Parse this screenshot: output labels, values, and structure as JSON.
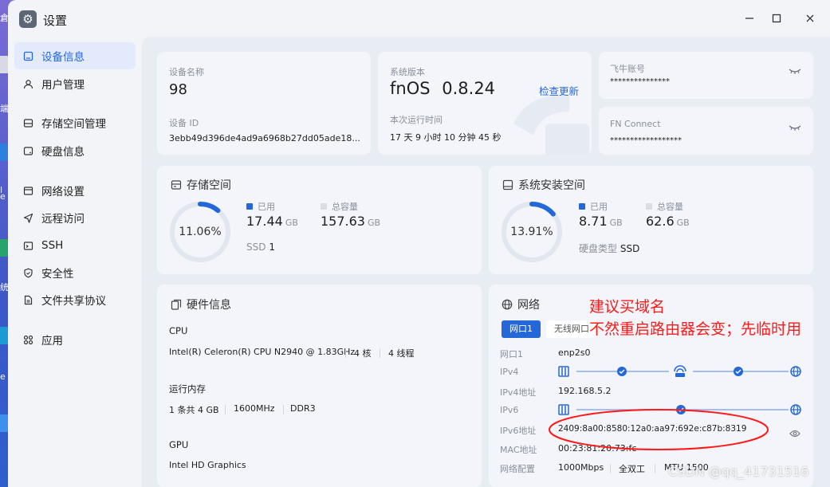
{
  "window": {
    "title": "设置"
  },
  "desktop": {
    "letters": [
      "倉",
      "端",
      "l",
      "e",
      "统",
      "e"
    ]
  },
  "sidebar": {
    "items": [
      {
        "label": "设备信息",
        "icon": "device-icon",
        "active": true
      },
      {
        "label": "用户管理",
        "icon": "user-icon"
      },
      {
        "label": "存储空间管理",
        "icon": "storage-icon"
      },
      {
        "label": "硬盘信息",
        "icon": "disk-icon"
      },
      {
        "label": "网络设置",
        "icon": "network-icon"
      },
      {
        "label": "远程访问",
        "icon": "remote-icon"
      },
      {
        "label": "SSH",
        "icon": "ssh-icon"
      },
      {
        "label": "安全性",
        "icon": "shield-icon"
      },
      {
        "label": "文件共享协议",
        "icon": "file-share-icon"
      },
      {
        "label": "应用",
        "icon": "apps-icon"
      }
    ]
  },
  "device": {
    "name_label": "设备名称",
    "name": "98",
    "id_label": "设备 ID",
    "id": "3ebb49d396de4ad9a6968b27dd05ade18..."
  },
  "system": {
    "version_label": "系统版本",
    "os_name": "fnOS",
    "version": "0.8.24",
    "check_update": "检查更新",
    "uptime_label": "本次运行时间",
    "uptime": "17 天 9 小时 10 分钟 45 秒"
  },
  "feiniu": {
    "label": "飞牛账号",
    "value": "***************"
  },
  "fnconnect": {
    "label": "FN Connect",
    "value": "******************"
  },
  "storage": {
    "title": "存储空间",
    "percent_text": "11.06%",
    "percent": 11.06,
    "used_label": "已用",
    "used": "17.44",
    "used_unit": "GB",
    "total_label": "总容量",
    "total": "157.63",
    "total_unit": "GB",
    "ssd_label": "SSD",
    "ssd_count": "1"
  },
  "sysinstall": {
    "title": "系统安装空间",
    "percent_text": "13.91%",
    "percent": 13.91,
    "used_label": "已用",
    "used": "8.71",
    "used_unit": "GB",
    "total_label": "总容量",
    "total": "62.6",
    "total_unit": "GB",
    "disk_type_label": "硬盘类型",
    "disk_type": "SSD"
  },
  "hardware": {
    "title": "硬件信息",
    "cpu_label": "CPU",
    "cpu_model": "Intel(R) Celeron(R) CPU N2940 @ 1.83GHz",
    "cpu_cores": "4 核",
    "cpu_threads": "4 线程",
    "mem_label": "运行内存",
    "mem_count": "1 条共 4 GB",
    "mem_freq": "1600MHz",
    "mem_type": "DDR3",
    "gpu_label": "GPU",
    "gpu_model": "Intel HD Graphics"
  },
  "network": {
    "title": "网络",
    "tabs": [
      "网口1",
      "无线网口"
    ],
    "rows": [
      {
        "label": "网口1",
        "value": "enp2s0"
      },
      {
        "label": "IPv4",
        "value": ""
      },
      {
        "label": "IPv4地址",
        "value": "192.168.5.2"
      },
      {
        "label": "IPv6",
        "value": ""
      },
      {
        "label": "IPv6地址",
        "value": "2409:8a00:8580:12a0:aa97:692e:c87b:8319"
      },
      {
        "label": "MAC地址",
        "value": "00:23:81:20:73:fc"
      },
      {
        "label": "网络配置",
        "value": "1000Mbps"
      }
    ],
    "duplex": "全双工",
    "mtu": "MTU 1500"
  },
  "annotation": {
    "line1": "建议买域名",
    "line2": "不然重启路由器会变；先临时用"
  },
  "watermark": "CSDN @qq_41731516",
  "colors": {
    "accent": "#2467d9",
    "annotation": "#ff1a1a"
  }
}
